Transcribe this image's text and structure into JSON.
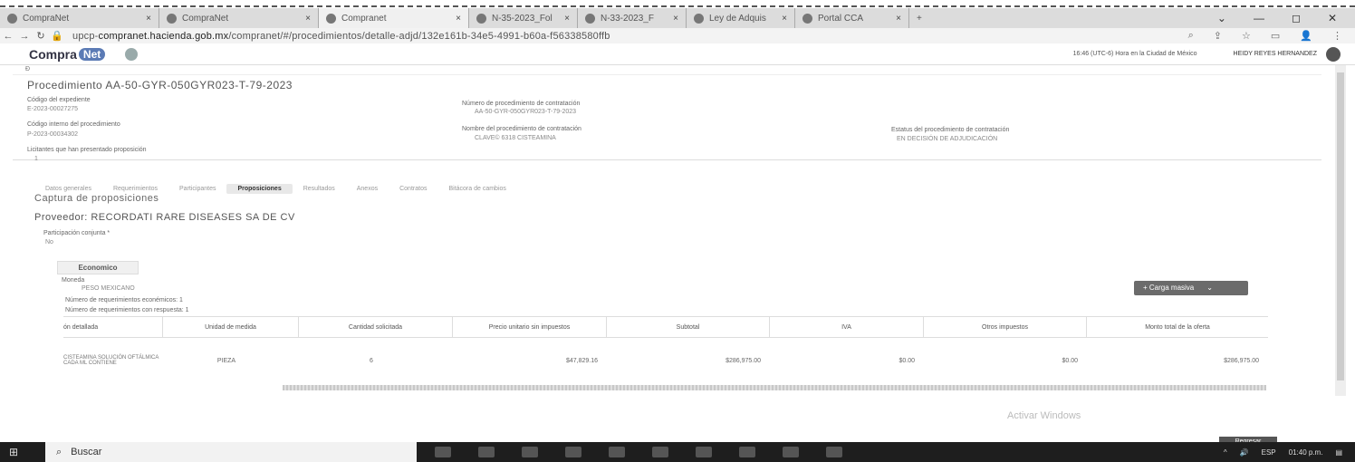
{
  "browser": {
    "tabs": [
      {
        "title": "CompraNet",
        "icon": "gear-icon",
        "close": "×"
      },
      {
        "title": "CompraNet",
        "icon": "page-icon",
        "close": "×"
      },
      {
        "title": "Compranet",
        "icon": "gear-icon",
        "close": "×",
        "active": true
      },
      {
        "title": "N-35-2023_Fol",
        "icon": "globe-icon",
        "close": "×"
      },
      {
        "title": "N-33-2023_F",
        "icon": "globe-icon",
        "close": "×"
      },
      {
        "title": "Ley de Adquis",
        "icon": "scale-icon",
        "close": "×"
      },
      {
        "title": "Portal CCA",
        "icon": "portal-icon",
        "close": "×"
      }
    ],
    "new_tab": "+",
    "url_prefix": "upcp-",
    "url_host": "compranet.hacienda.gob.mx",
    "url_path": "/compranet/#/procedimientos/detalle-adjd/132e161b-34e5-4991-b60a-f56338580ffb"
  },
  "app": {
    "logo_text": "Compra",
    "logo_badge": "Net",
    "timezone": "16:46 (UTC-6) Hora en la Ciudad de México",
    "user_name": "HEIDY REYES HERNANDEZ",
    "breadcrumb": "Ɖ"
  },
  "procedure": {
    "title": "Procedimiento AA-50-GYR-050GYR023-T-79-2023",
    "fields": {
      "expediente_label": "Código del expediente",
      "expediente_value": "E-2023-00027275",
      "interno_label": "Código interno del procedimiento",
      "interno_value": "P-2023-00034302",
      "licitantes_label": "Licitantes que han presentado proposición",
      "licitantes_value": "1",
      "numero_label": "Número de procedimiento de contratación",
      "numero_value": "AA-50-GYR-050GYR023-T-79-2023",
      "nombre_label": "Nombre del procedimiento de contratación",
      "nombre_value": "CLAVE© 6318 CISTEAMINA",
      "estatus_label": "Estatus del procedimiento de contratación",
      "estatus_value": "EN DECISIÓN DE ADJUDICACIÓN"
    }
  },
  "subtabs": [
    {
      "label": "Datos generales"
    },
    {
      "label": "Requerimientos"
    },
    {
      "label": "Participantes"
    },
    {
      "label": "Proposiciones",
      "active": true
    },
    {
      "label": "Resultados"
    },
    {
      "label": "Anexos"
    },
    {
      "label": "Contratos"
    },
    {
      "label": "Bitácora de cambios"
    }
  ],
  "captura_title": "Captura de proposiciones",
  "proveedor_title": "Proveedor: RECORDATI RARE DISEASES SA DE CV",
  "participacion_label": "Participación conjunta *",
  "participacion_value": "No",
  "economico_button": "Economico",
  "moneda_label": "Moneda",
  "moneda_value": "PESO MEXICANO",
  "req_count_label": "Número de requerimientos econémicos: 1",
  "req_resp_label": "Número de requerimientos con respuesta: 1",
  "carga_button": "+ Carga masiva",
  "table": {
    "headers": [
      "ón detallada",
      "Unidad de medida",
      "Cantidad solicitada",
      "Precio unitario sin impuestos",
      "Subtotal",
      "IVA",
      "Otros impuestos",
      "Monto total de la oferta"
    ],
    "row": {
      "descripcion": "CISTEAMINA SOLUCIÓN OFTÁLMICA CADA ML CONTIENE",
      "unidad": "PIEZA",
      "cantidad": "6",
      "precio": "$47,829.16",
      "subtotal": "$286,975.00",
      "iva": "$0.00",
      "otros": "$0.00",
      "total": "$286,975.00"
    }
  },
  "watermark": "Activar Windows",
  "regresar_button": "Regresar",
  "taskbar": {
    "search_placeholder": "Buscar",
    "tray_lang": "ESP",
    "tray_time": "01:40 p.m."
  }
}
